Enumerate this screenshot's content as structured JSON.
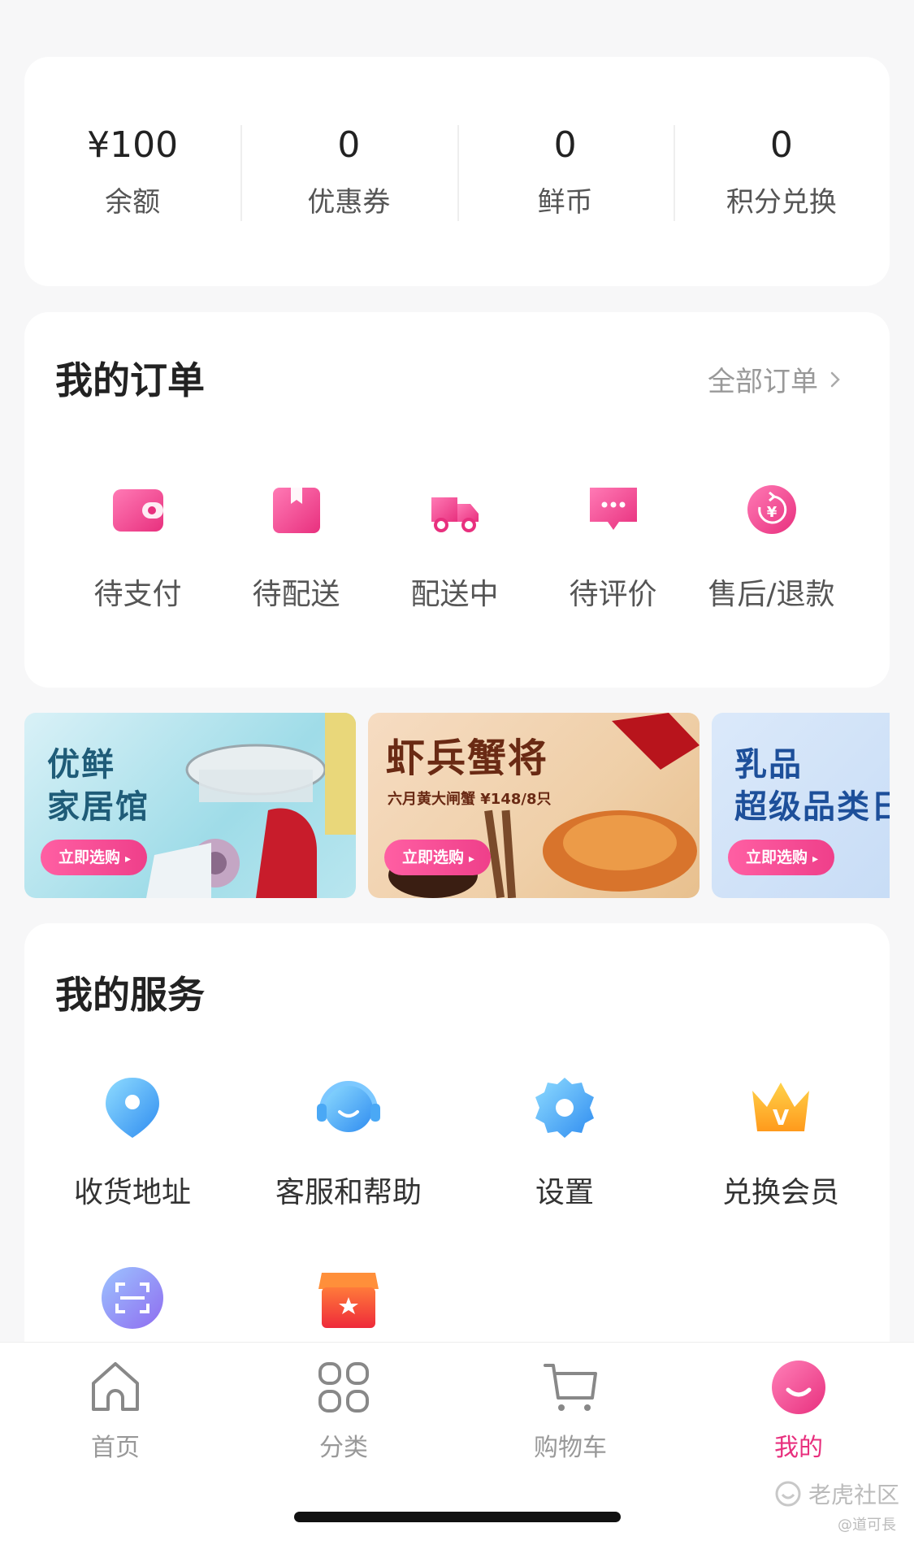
{
  "stats": [
    {
      "value": "¥100",
      "label": "余额"
    },
    {
      "value": "0",
      "label": "优惠券"
    },
    {
      "value": "0",
      "label": "鲜币"
    },
    {
      "value": "0",
      "label": "积分兑换"
    }
  ],
  "orders": {
    "title": "我的订单",
    "all_link": "全部订单",
    "items": [
      {
        "label": "待支付",
        "icon": "wallet-icon"
      },
      {
        "label": "待配送",
        "icon": "package-icon"
      },
      {
        "label": "配送中",
        "icon": "truck-icon"
      },
      {
        "label": "待评价",
        "icon": "comment-icon"
      },
      {
        "label": "售后/退款",
        "icon": "refund-icon"
      }
    ]
  },
  "banners": [
    {
      "title_line1": "优鲜",
      "title_line2": "家居馆",
      "button": "立即选购"
    },
    {
      "title": "虾兵蟹将",
      "subtitle": "六月黄大闸蟹 ¥148/8只",
      "button": "立即选购"
    },
    {
      "title_line1": "乳品",
      "title_line2": "超级品类日",
      "button": "立即选购"
    }
  ],
  "services": {
    "title": "我的服务",
    "items": [
      {
        "label": "收货地址",
        "icon": "location-pin-icon"
      },
      {
        "label": "客服和帮助",
        "icon": "headset-icon"
      },
      {
        "label": "设置",
        "icon": "gear-icon"
      },
      {
        "label": "兑换会员",
        "icon": "crown-icon"
      },
      {
        "label": "",
        "icon": "scan-icon"
      },
      {
        "label": "",
        "icon": "store-icon"
      }
    ]
  },
  "tabbar": {
    "tabs": [
      {
        "label": "首页",
        "icon": "home-icon"
      },
      {
        "label": "分类",
        "icon": "category-icon"
      },
      {
        "label": "购物车",
        "icon": "cart-icon"
      },
      {
        "label": "我的",
        "icon": "profile-icon",
        "active": true
      }
    ]
  },
  "watermark": {
    "text": "老虎社区",
    "sub": "@道可長"
  },
  "colors": {
    "accent": "#e8307e",
    "background": "#f7f7f8"
  }
}
